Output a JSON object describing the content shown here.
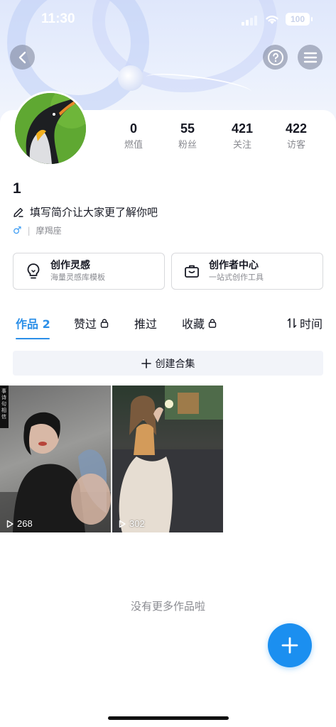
{
  "status_bar": {
    "time": "11:30",
    "battery": "100"
  },
  "header": {
    "back_icon": "chevron-left-icon",
    "help_icon": "question-circle-icon",
    "menu_icon": "hamburger-menu-icon"
  },
  "profile": {
    "nickname": "1",
    "bio_placeholder": "填写简介让大家更了解你吧",
    "gender_symbol": "♂",
    "zodiac": "摩羯座"
  },
  "stats": [
    {
      "value": "0",
      "label": "燃值"
    },
    {
      "value": "55",
      "label": "粉丝"
    },
    {
      "value": "421",
      "label": "关注"
    },
    {
      "value": "422",
      "label": "访客"
    }
  ],
  "tools": [
    {
      "title": "创作灵感",
      "subtitle": "海量灵感库模板",
      "icon": "lightbulb-icon"
    },
    {
      "title": "创作者中心",
      "subtitle": "一站式创作工具",
      "icon": "briefcase-icon"
    }
  ],
  "tabs": {
    "works": "作品 2",
    "likes": "赞过",
    "recommended": "推过",
    "favorites": "收藏",
    "sort": "时间"
  },
  "create_collection": "创建合集",
  "videos": [
    {
      "plays": "268",
      "overlay_text": "事诗句相信"
    },
    {
      "plays": "302"
    }
  ],
  "no_more_text": "没有更多作品啦",
  "colors": {
    "accent": "#2b8fe8",
    "fab": "#1b8ff0",
    "secondary_text": "#8a8b91"
  }
}
